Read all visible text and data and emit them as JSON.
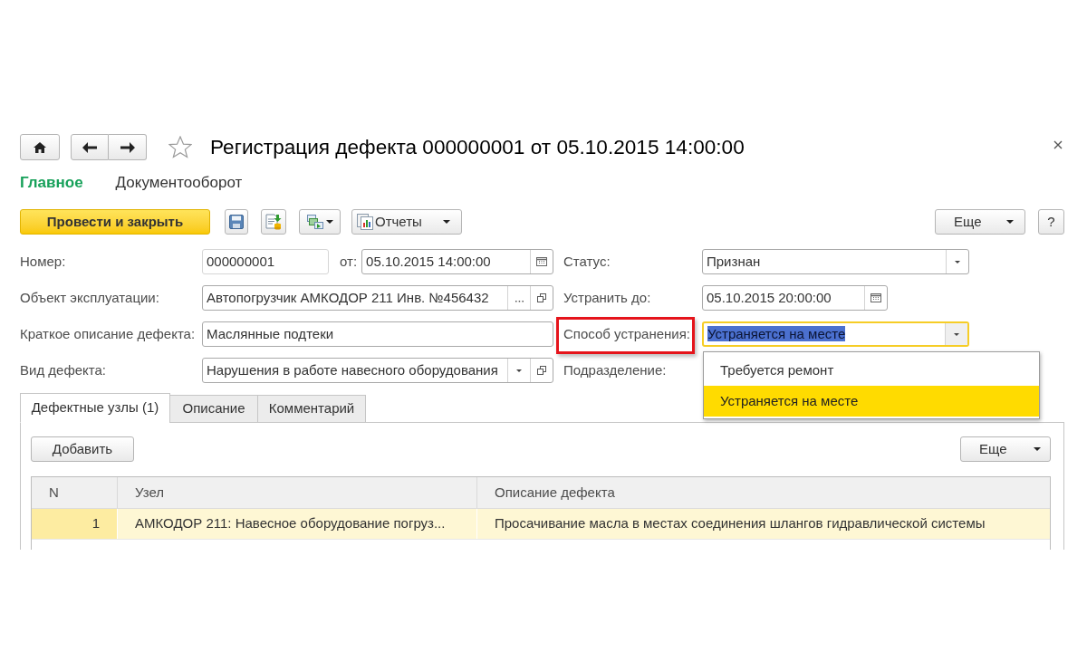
{
  "window": {
    "title": "Регистрация дефекта 000000001 от 05.10.2015 14:00:00"
  },
  "sections": [
    {
      "label": "Главное",
      "selected": true
    },
    {
      "label": "Документооборот",
      "selected": false
    }
  ],
  "toolbar": {
    "post_close": "Провести и закрыть",
    "reports": "Отчеты",
    "more": "Еще",
    "help": "?"
  },
  "form": {
    "left": [
      {
        "label": "Номер:",
        "value": "000000001",
        "kind": "number",
        "extra": {
          "label": "от:",
          "value": "05.10.2015 14:00:00",
          "kind": "date"
        }
      },
      {
        "label": "Объект эксплуатации:",
        "value": "Автопогрузчик АМКОДОР 211 Инв. №456432",
        "kind": "reference"
      },
      {
        "label": "Краткое описание дефекта:",
        "value": "Маслянные подтеки",
        "kind": "text"
      },
      {
        "label": "Вид дефекта:",
        "value": "Нарушения в работе навесного оборудования",
        "kind": "catalog"
      }
    ],
    "right": [
      {
        "label": "Статус:",
        "value": "Признан",
        "kind": "select"
      },
      {
        "label": "Устранить до:",
        "value": "05.10.2015 20:00:00",
        "kind": "date"
      },
      {
        "label": "Способ устранения:",
        "value": "Устраняется на месте",
        "kind": "select",
        "focused": true,
        "highlighted": true,
        "dropdown": [
          {
            "label": "Требуется ремонт",
            "selected": false
          },
          {
            "label": "Устраняется на месте",
            "selected": true
          }
        ]
      },
      {
        "label": "Подразделение:"
      }
    ]
  },
  "detail_tabs": [
    {
      "label": "Дефектные узлы (1)",
      "selected": true
    },
    {
      "label": "Описание",
      "selected": false
    },
    {
      "label": "Комментарий",
      "selected": false
    }
  ],
  "table_panel": {
    "add": "Добавить",
    "more": "Еще"
  },
  "table": {
    "columns": [
      "N",
      "Узел",
      "Описание дефекта"
    ],
    "rows": [
      {
        "cells": [
          "1",
          "АМКОДОР 211: Навесное оборудование погруз...",
          "Просачивание масла в местах соединения шлангов гидравлической системы"
        ],
        "selected": true
      }
    ]
  }
}
